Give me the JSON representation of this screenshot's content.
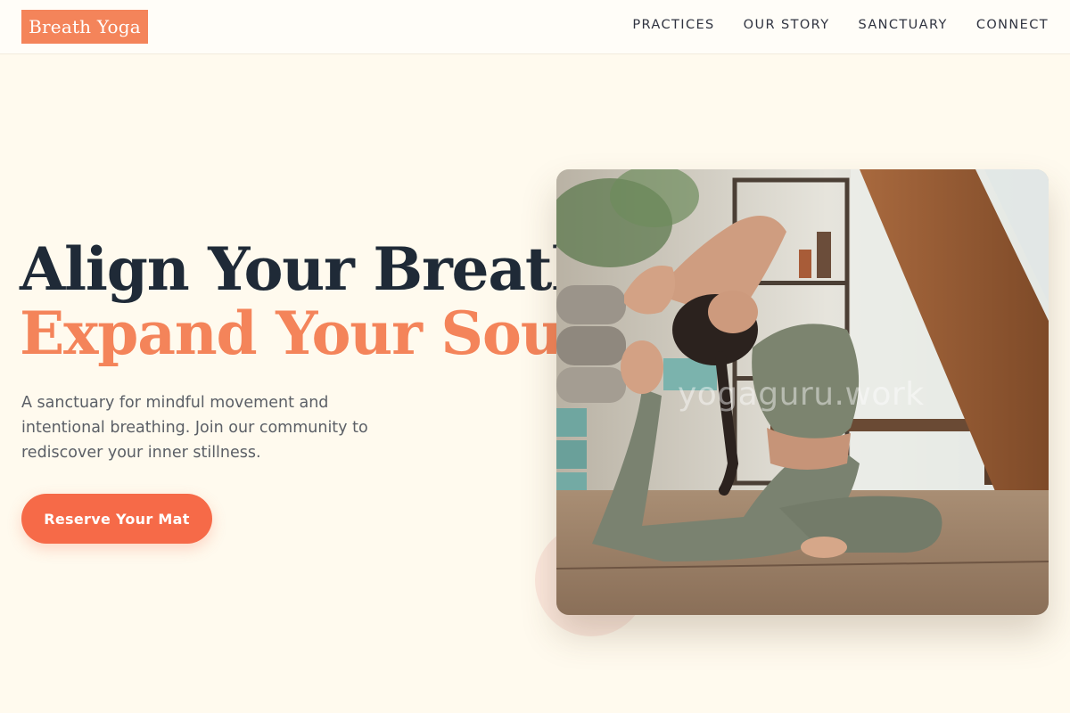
{
  "header": {
    "logo": "Breath Yoga",
    "nav": [
      "PRACTICES",
      "OUR STORY",
      "SANCTUARY",
      "CONNECT"
    ]
  },
  "hero": {
    "headline_line1": "Align Your Breath,",
    "headline_line2": "Expand Your Soul.",
    "subtext": "A sanctuary for mindful movement and intentional breathing. Join our community to rediscover your inner stillness.",
    "cta_label": "Reserve Your Mat",
    "image_watermark": "yogaguru.work"
  },
  "colors": {
    "background": "#fffaee",
    "accent": "#f4845a",
    "cta": "#f66a48",
    "headline_dark": "#1f2a37",
    "body_text": "#5b5f66"
  }
}
